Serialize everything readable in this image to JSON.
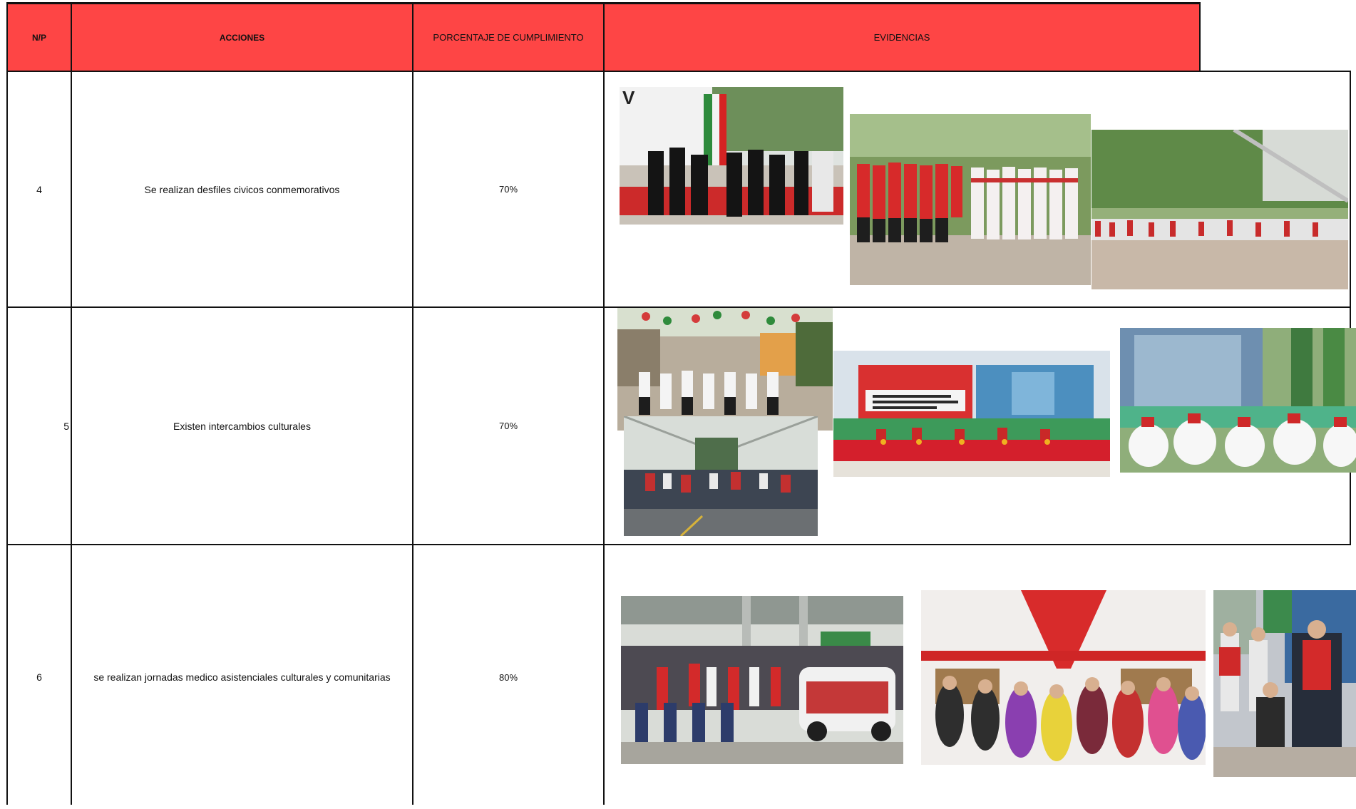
{
  "header": {
    "np": "N/P",
    "acciones": "ACCIONES",
    "porcentaje": "PORCENTAJE DE CUMPLIMIENTO",
    "evidencias": "EVIDENCIAS"
  },
  "rows": [
    {
      "np": "4",
      "accion": "Se realizan desfiles civicos conmemorativos",
      "porcentaje": "70%",
      "evidencias": [
        "photo-parade-soldiers-flag",
        "photo-parade-group-red-white",
        "photo-parade-plaza-crowd"
      ]
    },
    {
      "np": "5",
      "accion": "Existen intercambios culturales",
      "porcentaje": "70%",
      "evidencias": [
        "photo-street-parade-flags",
        "photo-group-pavilion",
        "photo-event-stage-banner",
        "photo-folk-dancers"
      ]
    },
    {
      "np": "6",
      "accion": "se realizan jornadas medico asistenciales culturales y comunitarias",
      "porcentaje": "80%",
      "evidencias": [
        "photo-community-crowd-vehicle",
        "photo-tent-group-women",
        "photo-volunteers-street"
      ]
    }
  ],
  "colors": {
    "header_bg": "#fe4545",
    "grid": "#111111"
  }
}
